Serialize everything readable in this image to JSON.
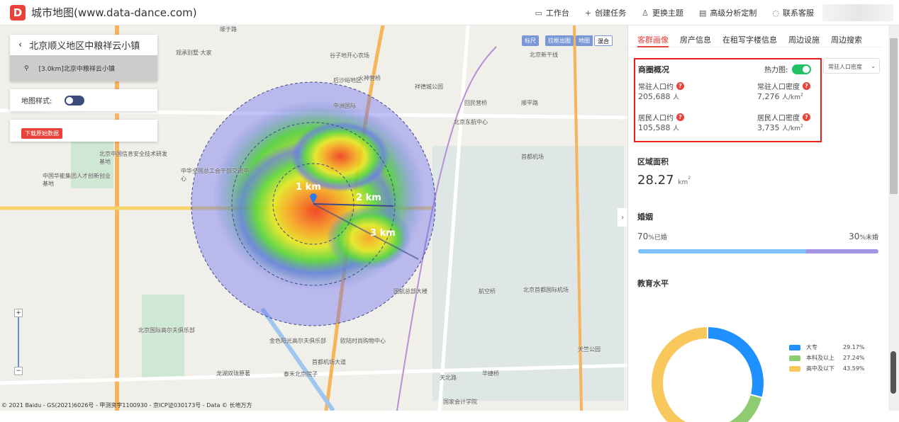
{
  "header": {
    "logo_letter": "D",
    "title": "城市地图(www.data-dance.com)",
    "nav": [
      {
        "icon": "monitor-icon",
        "glyph": "▭",
        "label": "工作台"
      },
      {
        "icon": "plus-icon",
        "glyph": "+",
        "label": "创建任务"
      },
      {
        "icon": "shirt-icon",
        "glyph": "♙",
        "label": "更换主题"
      },
      {
        "icon": "calendar-icon",
        "glyph": "▤",
        "label": "高级分析定制"
      },
      {
        "icon": "headset-icon",
        "glyph": "◌",
        "label": "联系客服"
      }
    ]
  },
  "map": {
    "location_title": "北京顺义地区中粮祥云小镇",
    "location_item": "[3.0km]北京中粮祥云小镇",
    "map_style_label": "地图样式:",
    "map_style_on": false,
    "download_button": "下载原始数据",
    "controls": {
      "ruler": "标尺",
      "box": "拉框出图",
      "map": "地图",
      "hybrid": "混合"
    },
    "ring_labels": [
      "1 km",
      "2 km",
      "3 km"
    ],
    "places": [
      "顺于路",
      "观承别墅·大家",
      "谷子地开心农场",
      "后沙峪地区",
      "火神营桥",
      "祥德城公园",
      "北京新干线",
      "天北路",
      "中洲国际",
      "回民营桥",
      "顺平路",
      "北京东航中心",
      "北京中国信息安全技术研发基地",
      "中国华能集团人才创新创业基地",
      "中华全国总工会干部交流中心",
      "首都机场",
      "航空桥",
      "北京首都国际机场",
      "国航总部大楼",
      "欧陆时尚购物中心",
      "北京国际高尔夫俱乐部",
      "龙湖双珑原著",
      "泰禾北京院子",
      "金色阳光高尔夫俱乐部",
      "首都机场大道",
      "国家会计学院",
      "华捷桥",
      "天竺公园"
    ],
    "attribution": "© 2021 Baidu - GS(2021)6026号 - 甲测资字1100930 - 京ICP证030173号 - Data © 长地万方"
  },
  "panel": {
    "tabs": [
      "客群画像",
      "房产信息",
      "在租写字楼信息",
      "周边设施",
      "周边搜索"
    ],
    "active_tab": 0,
    "overview": {
      "title": "商圈概况",
      "heatmap_label": "热力图:",
      "heatmap_on": true,
      "dropdown": "常驻人口密度",
      "stats": [
        {
          "label": "常驻人口约",
          "value": "205,688",
          "unit": "人"
        },
        {
          "label": "常驻人口密度",
          "value": "7,276",
          "unit": "人/km",
          "sup": "2"
        },
        {
          "label": "居民人口约",
          "value": "105,588",
          "unit": "人"
        },
        {
          "label": "居民人口密度",
          "value": "3,735",
          "unit": "人/km",
          "sup": "2"
        }
      ]
    },
    "area": {
      "title": "区域面积",
      "value": "28.27",
      "unit": "km",
      "sup": "2"
    },
    "marriage": {
      "title": "婚姻",
      "married_pct": "70",
      "married_label": "%已婚",
      "single_pct": "30",
      "single_label": "%未婚",
      "married_fraction": 0.7,
      "colors": {
        "married": "#7ec1fb",
        "single": "#a394e6"
      }
    },
    "education": {
      "title": "教育水平",
      "chart_data": {
        "type": "pie",
        "donut": true,
        "categories": [
          "大专",
          "本科及以上",
          "高中及以下"
        ],
        "values": [
          29.17,
          27.24,
          43.59
        ],
        "labels": [
          "29.17%",
          "27.24%",
          "43.59%"
        ],
        "colors": [
          "#1e90ff",
          "#8fcc6f",
          "#f9c85c"
        ],
        "legend": "right"
      }
    }
  },
  "colors": {
    "accent": "#e8423b",
    "toggle_on": "#1fc162",
    "toggle_off": "#3d4b7a"
  }
}
